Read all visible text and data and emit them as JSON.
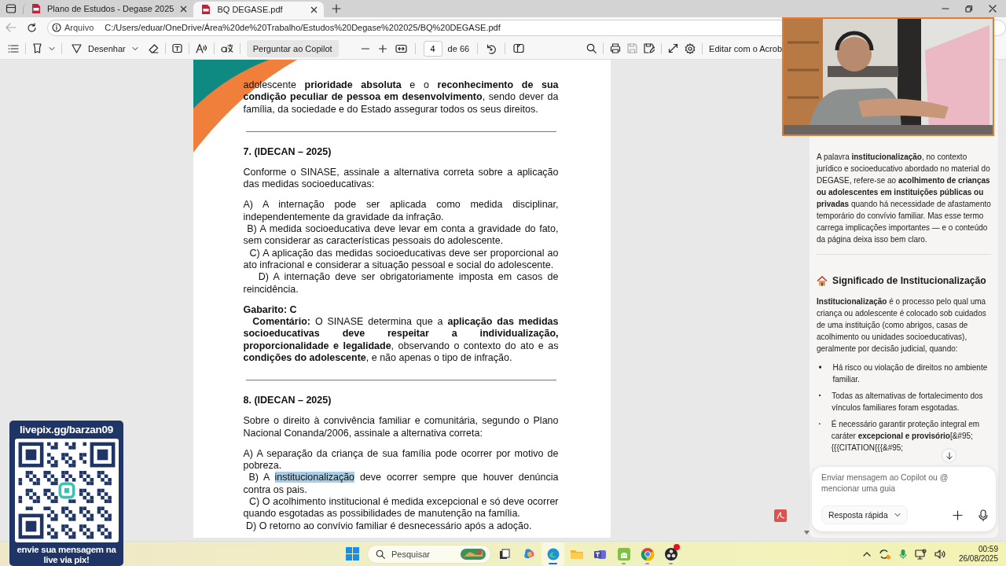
{
  "browser": {
    "tabs": [
      {
        "title": "Plano de Estudos - Degase 2025",
        "selected": false
      },
      {
        "title": "BQ DEGASE.pdf",
        "selected": true
      }
    ],
    "address": {
      "scheme": "Arquivo",
      "url": "C:/Users/eduar/OneDrive/Área%20de%20Trabalho/Estudos%20Degase%202025/BQ%20DEGASE.pdf"
    }
  },
  "pdf_toolbar": {
    "draw_label": "Desenhar",
    "ask_copilot": "Perguntar ao Copilot",
    "page": "4",
    "page_count": "de 66",
    "edit_label": "Editar com o Acrob"
  },
  "document": {
    "blocks": [
      {
        "kind": "text",
        "text": "adolescente **prioridade absoluta** e o **reconhecimento de sua condição peculiar de pessoa em desenvolvimento**, sendo dever da família, da sociedade e do Estado assegurar todos os seus direitos."
      },
      {
        "kind": "rule"
      },
      {
        "kind": "heading",
        "text": "7. (IDECAN – 2025)"
      },
      {
        "kind": "text",
        "text": "Conforme o SINASE, assinale a alternativa correta sobre a aplicação das medidas socioeducativas:"
      },
      {
        "kind": "text",
        "text": "A) A internação pode ser aplicada como medida disciplinar, independentemente da gravidade da infração."
      },
      {
        "kind": "line",
        "text": " B) A medida socioeducativa deve levar em conta a gravidade do fato, sem considerar as características pessoais do adolescente."
      },
      {
        "kind": "line",
        "text": "  C) A aplicação das medidas socioeducativas deve ser proporcional ao ato infracional e considerar a situação pessoal e social do adolescente."
      },
      {
        "kind": "line",
        "text": "   D) A internação deve ser obrigatoriamente imposta em casos de reincidência."
      },
      {
        "kind": "heading",
        "text": "Gabarito: C"
      },
      {
        "kind": "line",
        "text": "  **Comentário:** O SINASE determina que a **aplicação das medidas socioeducativas deve respeitar a individualização, proporcionalidade e legalidade**, observando o contexto do ato e as **condições do adolescente**, e não apenas o tipo de infração."
      },
      {
        "kind": "rule"
      },
      {
        "kind": "heading",
        "text": "8. (IDECAN – 2025)"
      },
      {
        "kind": "text",
        "text": "Sobre o direito à convivência familiar e comunitária, segundo o Plano Nacional Conanda/2006, assinale a alternativa correta:"
      },
      {
        "kind": "text",
        "text": "A) A separação da criança de sua família pode ocorrer por motivo de pobreza."
      },
      {
        "kind": "line",
        "segments": [
          {
            "text": " B) A ",
            "highlighted": false
          },
          {
            "text": "institucionalização",
            "highlighted": true
          },
          {
            "text": " deve ocorrer sempre que houver denúncia contra os pais.",
            "highlighted": false
          }
        ]
      },
      {
        "kind": "line",
        "text": "  C) O acolhimento institucional é medida excepcional e só deve ocorrer quando esgotadas as possibilidades de manutenção na família."
      },
      {
        "kind": "line",
        "text": " D) O retorno ao convívio familiar é desnecessário após a adoção."
      }
    ]
  },
  "copilot": {
    "blocks": [
      {
        "kind": "paragraph",
        "text": "A palavra **institucionalização**, no contexto jurídico e socioeducativo abordado no material do DEGASE, refere-se ao **acolhimento de crianças ou adolescentes em instituições públicas ou privadas** quando há necessidade de afastamento temporário do convívio familiar. Mas esse termo carrega implicações importantes — e o conteúdo da página deixa isso bem claro."
      },
      {
        "kind": "divider"
      },
      {
        "kind": "heading",
        "text": "Significado de Institucionalização"
      },
      {
        "kind": "paragraph",
        "text": "**Institucionalização** é o processo pelo qual uma criança ou adolescente é colocado sob cuidados de uma instituição (como abrigos, casas de acolhimento ou unidades socioeducativas), geralmente por decisão judicial, quando:"
      },
      {
        "kind": "bullet",
        "text": "Há risco ou violação de direitos no ambiente familiar."
      },
      {
        "kind": "bullet",
        "text": "Todas as alternativas de fortalecimento dos vínculos familiares foram esgotadas."
      },
      {
        "kind": "bullet",
        "text": "É necessário garantir proteção integral em caráter **excepcional e provisório**[&#95; {{{CITATION{{{&#95;"
      }
    ],
    "placeholder": "Enviar mensagem ao Copilot ou @ mencionar uma guia",
    "mode": "Resposta rápida"
  },
  "stream_overlay": {
    "top": "livepix.gg/barzan09",
    "bottom": "envie sua mensagem na live via pix!"
  },
  "taskbar": {
    "search_placeholder": "Pesquisar",
    "apps": [
      {
        "kind": "copilot",
        "running": false,
        "active": false,
        "alert": false
      },
      {
        "kind": "edge",
        "running": true,
        "active": true,
        "alert": false
      },
      {
        "kind": "folder",
        "running": false,
        "active": false,
        "alert": false
      },
      {
        "kind": "teams",
        "running": false,
        "active": false,
        "alert": false
      },
      {
        "kind": "android",
        "running": true,
        "active": false,
        "alert": false
      },
      {
        "kind": "chrome",
        "running": true,
        "active": false,
        "alert": false
      },
      {
        "kind": "obs",
        "running": true,
        "active": false,
        "alert": true
      }
    ],
    "time": "00:59",
    "date": "26/08/2025"
  }
}
